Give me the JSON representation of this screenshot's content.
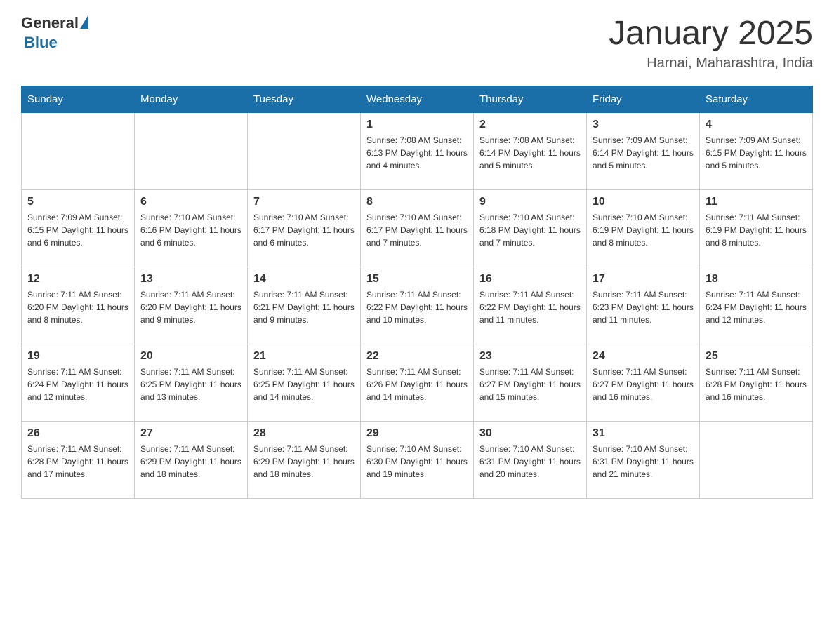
{
  "header": {
    "logo": {
      "general": "General",
      "blue": "Blue"
    },
    "title": "January 2025",
    "location": "Harnai, Maharashtra, India"
  },
  "days_of_week": [
    "Sunday",
    "Monday",
    "Tuesday",
    "Wednesday",
    "Thursday",
    "Friday",
    "Saturday"
  ],
  "weeks": [
    [
      {
        "day": "",
        "info": ""
      },
      {
        "day": "",
        "info": ""
      },
      {
        "day": "",
        "info": ""
      },
      {
        "day": "1",
        "info": "Sunrise: 7:08 AM\nSunset: 6:13 PM\nDaylight: 11 hours\nand 4 minutes."
      },
      {
        "day": "2",
        "info": "Sunrise: 7:08 AM\nSunset: 6:14 PM\nDaylight: 11 hours\nand 5 minutes."
      },
      {
        "day": "3",
        "info": "Sunrise: 7:09 AM\nSunset: 6:14 PM\nDaylight: 11 hours\nand 5 minutes."
      },
      {
        "day": "4",
        "info": "Sunrise: 7:09 AM\nSunset: 6:15 PM\nDaylight: 11 hours\nand 5 minutes."
      }
    ],
    [
      {
        "day": "5",
        "info": "Sunrise: 7:09 AM\nSunset: 6:15 PM\nDaylight: 11 hours\nand 6 minutes."
      },
      {
        "day": "6",
        "info": "Sunrise: 7:10 AM\nSunset: 6:16 PM\nDaylight: 11 hours\nand 6 minutes."
      },
      {
        "day": "7",
        "info": "Sunrise: 7:10 AM\nSunset: 6:17 PM\nDaylight: 11 hours\nand 6 minutes."
      },
      {
        "day": "8",
        "info": "Sunrise: 7:10 AM\nSunset: 6:17 PM\nDaylight: 11 hours\nand 7 minutes."
      },
      {
        "day": "9",
        "info": "Sunrise: 7:10 AM\nSunset: 6:18 PM\nDaylight: 11 hours\nand 7 minutes."
      },
      {
        "day": "10",
        "info": "Sunrise: 7:10 AM\nSunset: 6:19 PM\nDaylight: 11 hours\nand 8 minutes."
      },
      {
        "day": "11",
        "info": "Sunrise: 7:11 AM\nSunset: 6:19 PM\nDaylight: 11 hours\nand 8 minutes."
      }
    ],
    [
      {
        "day": "12",
        "info": "Sunrise: 7:11 AM\nSunset: 6:20 PM\nDaylight: 11 hours\nand 8 minutes."
      },
      {
        "day": "13",
        "info": "Sunrise: 7:11 AM\nSunset: 6:20 PM\nDaylight: 11 hours\nand 9 minutes."
      },
      {
        "day": "14",
        "info": "Sunrise: 7:11 AM\nSunset: 6:21 PM\nDaylight: 11 hours\nand 9 minutes."
      },
      {
        "day": "15",
        "info": "Sunrise: 7:11 AM\nSunset: 6:22 PM\nDaylight: 11 hours\nand 10 minutes."
      },
      {
        "day": "16",
        "info": "Sunrise: 7:11 AM\nSunset: 6:22 PM\nDaylight: 11 hours\nand 11 minutes."
      },
      {
        "day": "17",
        "info": "Sunrise: 7:11 AM\nSunset: 6:23 PM\nDaylight: 11 hours\nand 11 minutes."
      },
      {
        "day": "18",
        "info": "Sunrise: 7:11 AM\nSunset: 6:24 PM\nDaylight: 11 hours\nand 12 minutes."
      }
    ],
    [
      {
        "day": "19",
        "info": "Sunrise: 7:11 AM\nSunset: 6:24 PM\nDaylight: 11 hours\nand 12 minutes."
      },
      {
        "day": "20",
        "info": "Sunrise: 7:11 AM\nSunset: 6:25 PM\nDaylight: 11 hours\nand 13 minutes."
      },
      {
        "day": "21",
        "info": "Sunrise: 7:11 AM\nSunset: 6:25 PM\nDaylight: 11 hours\nand 14 minutes."
      },
      {
        "day": "22",
        "info": "Sunrise: 7:11 AM\nSunset: 6:26 PM\nDaylight: 11 hours\nand 14 minutes."
      },
      {
        "day": "23",
        "info": "Sunrise: 7:11 AM\nSunset: 6:27 PM\nDaylight: 11 hours\nand 15 minutes."
      },
      {
        "day": "24",
        "info": "Sunrise: 7:11 AM\nSunset: 6:27 PM\nDaylight: 11 hours\nand 16 minutes."
      },
      {
        "day": "25",
        "info": "Sunrise: 7:11 AM\nSunset: 6:28 PM\nDaylight: 11 hours\nand 16 minutes."
      }
    ],
    [
      {
        "day": "26",
        "info": "Sunrise: 7:11 AM\nSunset: 6:28 PM\nDaylight: 11 hours\nand 17 minutes."
      },
      {
        "day": "27",
        "info": "Sunrise: 7:11 AM\nSunset: 6:29 PM\nDaylight: 11 hours\nand 18 minutes."
      },
      {
        "day": "28",
        "info": "Sunrise: 7:11 AM\nSunset: 6:29 PM\nDaylight: 11 hours\nand 18 minutes."
      },
      {
        "day": "29",
        "info": "Sunrise: 7:10 AM\nSunset: 6:30 PM\nDaylight: 11 hours\nand 19 minutes."
      },
      {
        "day": "30",
        "info": "Sunrise: 7:10 AM\nSunset: 6:31 PM\nDaylight: 11 hours\nand 20 minutes."
      },
      {
        "day": "31",
        "info": "Sunrise: 7:10 AM\nSunset: 6:31 PM\nDaylight: 11 hours\nand 21 minutes."
      },
      {
        "day": "",
        "info": ""
      }
    ]
  ]
}
